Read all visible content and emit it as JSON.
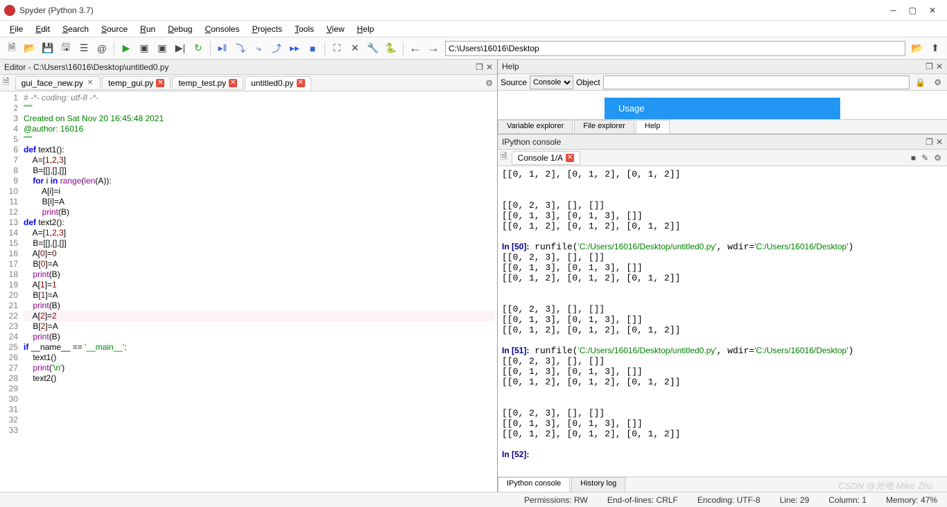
{
  "window": {
    "title": "Spyder (Python 3.7)"
  },
  "menu": [
    "File",
    "Edit",
    "Search",
    "Source",
    "Run",
    "Debug",
    "Consoles",
    "Projects",
    "Tools",
    "View",
    "Help"
  ],
  "menu_accel": [
    0,
    0,
    0,
    0,
    0,
    0,
    0,
    0,
    0,
    0,
    0
  ],
  "path": "C:\\Users\\16016\\Desktop",
  "editor": {
    "header": "Editor - C:\\Users\\16016\\Desktop\\untitled0.py",
    "tabs": [
      {
        "name": "gui_face_new.py",
        "active": false,
        "dirty": false
      },
      {
        "name": "temp_gui.py",
        "active": false,
        "dirty": true
      },
      {
        "name": "temp_test.py",
        "active": false,
        "dirty": true
      },
      {
        "name": "untitled0.py",
        "active": true,
        "dirty": true
      }
    ],
    "lines": [
      {
        "n": 1,
        "html": "<span class='c-comment'># -*- coding: utf-8 -*-</span>"
      },
      {
        "n": 2,
        "html": "<span class='c-str'>\"\"\"</span>"
      },
      {
        "n": 3,
        "html": "<span class='c-str'>Created on Sat Nov 20 16:45:48 2021</span>"
      },
      {
        "n": 4,
        "html": ""
      },
      {
        "n": 5,
        "html": "<span class='c-str'>@author: 16016</span>"
      },
      {
        "n": 6,
        "html": "<span class='c-str'>\"\"\"</span>"
      },
      {
        "n": 7,
        "html": ""
      },
      {
        "n": 8,
        "html": "<span class='c-key'>def</span> <span class='c-name'>text1</span>():"
      },
      {
        "n": 9,
        "html": "    A=[<span class='c-num'>1</span>,<span class='c-num'>2</span>,<span class='c-num'>3</span>]"
      },
      {
        "n": 10,
        "html": "    B=[[],[],[]]"
      },
      {
        "n": 11,
        "html": "    <span class='c-key'>for</span> i <span class='c-key'>in</span> <span class='c-builtin'>range</span>(<span class='c-builtin'>len</span>(A)):"
      },
      {
        "n": 12,
        "html": "        A[i]=i"
      },
      {
        "n": 13,
        "html": "        B[i]=A"
      },
      {
        "n": 14,
        "html": "        <span class='c-builtin'>print</span>(B)"
      },
      {
        "n": 15,
        "html": ""
      },
      {
        "n": 16,
        "html": "<span class='c-key'>def</span> <span class='c-name'>text2</span>():"
      },
      {
        "n": 17,
        "html": "    A=[<span class='c-num'>1</span>,<span class='c-num'>2</span>,<span class='c-num'>3</span>]"
      },
      {
        "n": 18,
        "html": "    B=[[],[],[]]"
      },
      {
        "n": 19,
        "html": ""
      },
      {
        "n": 20,
        "html": "    A[<span class='c-num'>0</span>]=<span class='c-num'>0</span>"
      },
      {
        "n": 21,
        "html": "    B[<span class='c-num'>0</span>]=A"
      },
      {
        "n": 22,
        "html": "    <span class='c-builtin'>print</span>(B)"
      },
      {
        "n": 23,
        "html": "    A[<span class='c-num'>1</span>]=<span class='c-num'>1</span>"
      },
      {
        "n": 24,
        "html": "    B[<span class='c-num'>1</span>]=A"
      },
      {
        "n": 25,
        "html": "    <span class='c-builtin'>print</span>(B)"
      },
      {
        "n": 26,
        "html": "    A[<span class='c-num'>2</span>]=<span class='c-num'>2</span>",
        "hl": true
      },
      {
        "n": 27,
        "html": "    B[<span class='c-num'>2</span>]=A"
      },
      {
        "n": 28,
        "html": "    <span class='c-builtin'>print</span>(B)"
      },
      {
        "n": 29,
        "html": ""
      },
      {
        "n": 30,
        "html": "<span class='c-key'>if</span> __name__ == <span class='c-str'>'__main__'</span>:"
      },
      {
        "n": 31,
        "html": "    text1()"
      },
      {
        "n": 32,
        "html": "    <span class='c-builtin'>print</span>(<span class='c-str'>'\\n'</span>)"
      },
      {
        "n": 33,
        "html": "    text2()"
      }
    ]
  },
  "help": {
    "header": "Help",
    "source_label": "Source",
    "source_value": "Console",
    "object_label": "Object",
    "usage_label": "Usage",
    "bottom_tabs": [
      "Variable explorer",
      "File explorer",
      "Help"
    ],
    "active_tab": 2
  },
  "console": {
    "header": "IPython console",
    "tab": "Console 1/A",
    "output": [
      "[[0, 1, 2], [0, 1, 2], [0, 1, 2]]",
      "",
      "",
      "[[0, 2, 3], [], []]",
      "[[0, 1, 3], [0, 1, 3], []]",
      "[[0, 1, 2], [0, 1, 2], [0, 1, 2]]",
      "",
      {
        "type": "in",
        "n": 50,
        "cmd": "runfile(",
        "path": "'C:/Users/16016/Desktop/untitled0.py'",
        "mid": ", wdir=",
        "path2": "'C:/Users/16016/Desktop'",
        "end": ")"
      },
      "[[0, 2, 3], [], []]",
      "[[0, 1, 3], [0, 1, 3], []]",
      "[[0, 1, 2], [0, 1, 2], [0, 1, 2]]",
      "",
      "",
      "[[0, 2, 3], [], []]",
      "[[0, 1, 3], [0, 1, 3], []]",
      "[[0, 1, 2], [0, 1, 2], [0, 1, 2]]",
      "",
      {
        "type": "in",
        "n": 51,
        "cmd": "runfile(",
        "path": "'C:/Users/16016/Desktop/untitled0.py'",
        "mid": ", wdir=",
        "path2": "'C:/Users/16016/Desktop'",
        "end": ")"
      },
      "[[0, 2, 3], [], []]",
      "[[0, 1, 3], [0, 1, 3], []]",
      "[[0, 1, 2], [0, 1, 2], [0, 1, 2]]",
      "",
      "",
      "[[0, 2, 3], [], []]",
      "[[0, 1, 3], [0, 1, 3], []]",
      "[[0, 1, 2], [0, 1, 2], [0, 1, 2]]",
      "",
      {
        "type": "in",
        "n": 52,
        "cmd": "",
        "path": "",
        "mid": "",
        "path2": "",
        "end": ""
      }
    ],
    "bottom_tabs": [
      "IPython console",
      "History log"
    ]
  },
  "status": {
    "permissions": "Permissions: RW",
    "eol": "End-of-lines: CRLF",
    "encoding": "Encoding: UTF-8",
    "line": "Line: 29",
    "column": "Column: 1",
    "memory": "Memory: 47%"
  },
  "watermark": "CSDN @光电 Mike Zhu"
}
